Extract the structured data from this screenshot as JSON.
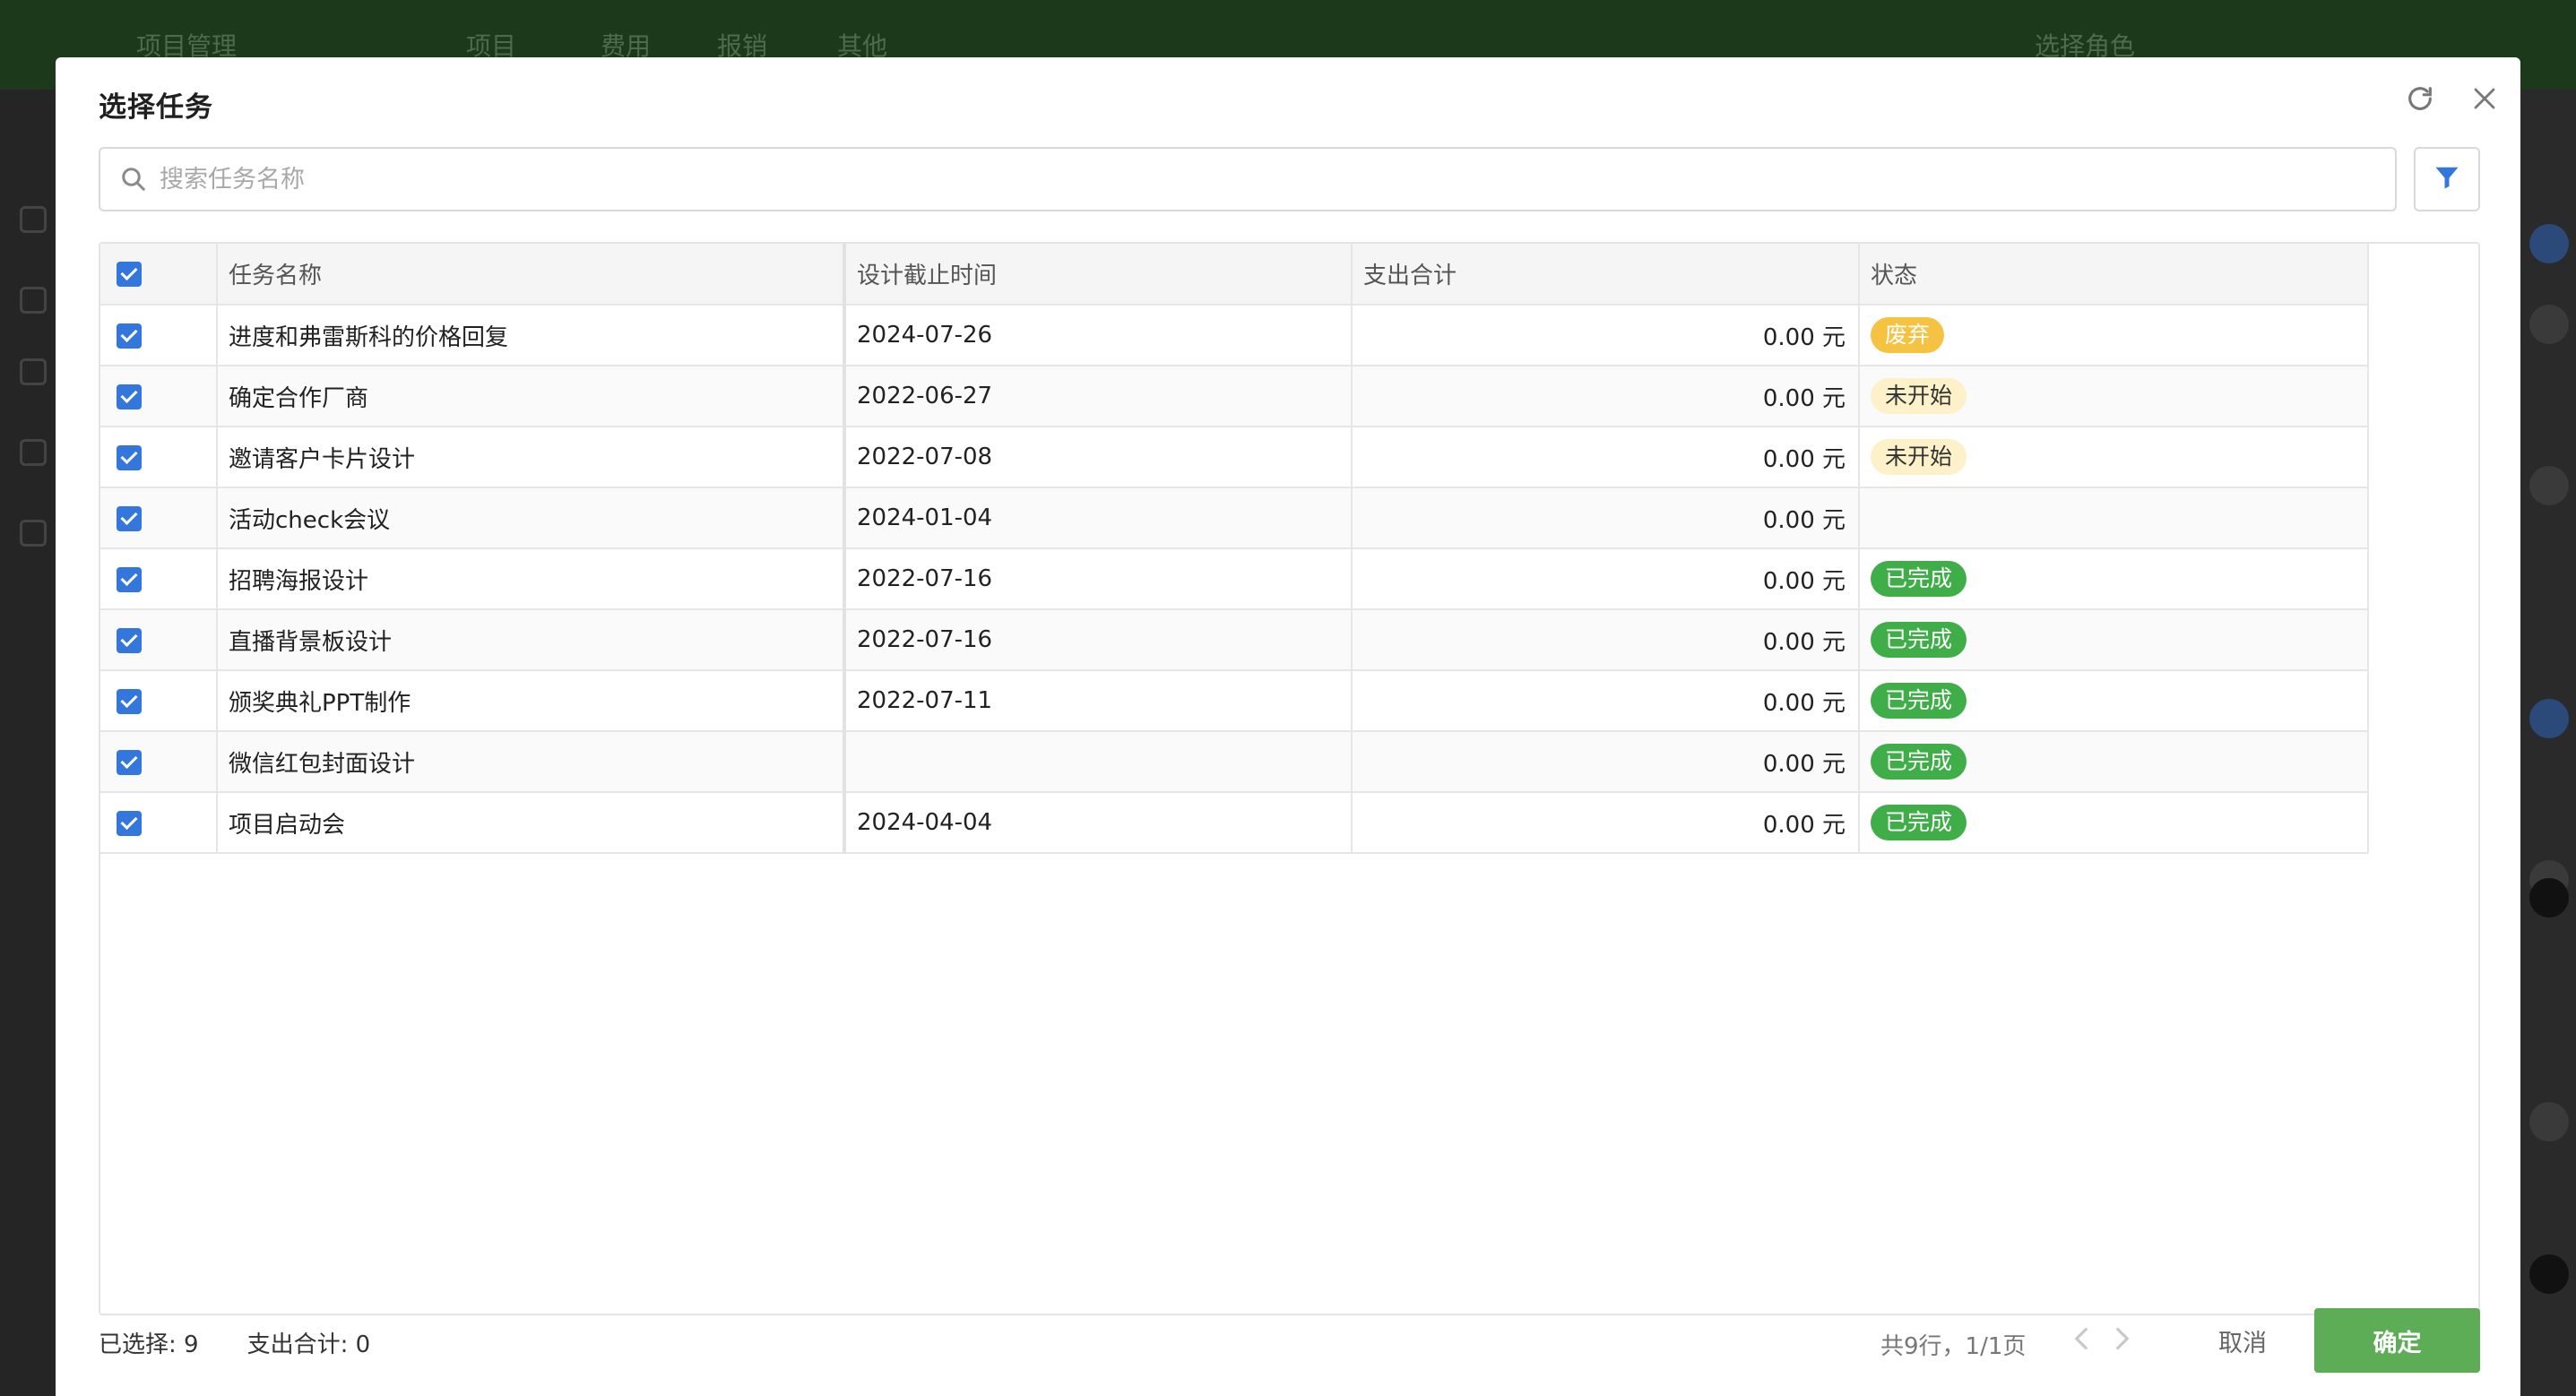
{
  "background": {
    "nav": [
      "项目管理",
      "项目",
      "费用",
      "报销",
      "其他"
    ],
    "role_select": "选择角色"
  },
  "dialog": {
    "title": "选择任务",
    "search_placeholder": "搜索任务名称",
    "columns": [
      "任务名称",
      "设计截止时间",
      "支出合计",
      "状态"
    ],
    "rows": [
      {
        "name": "进度和弗雷斯科的价格回复",
        "deadline": "2024-07-26",
        "expense": "0.00 元",
        "status": "废弃",
        "status_type": "abandon"
      },
      {
        "name": "确定合作厂商",
        "deadline": "2022-06-27",
        "expense": "0.00 元",
        "status": "未开始",
        "status_type": "notstart"
      },
      {
        "name": "邀请客户卡片设计",
        "deadline": "2022-07-08",
        "expense": "0.00 元",
        "status": "未开始",
        "status_type": "notstart"
      },
      {
        "name": "活动check会议",
        "deadline": "2024-01-04",
        "expense": "0.00 元",
        "status": "",
        "status_type": "none"
      },
      {
        "name": "招聘海报设计",
        "deadline": "2022-07-16",
        "expense": "0.00 元",
        "status": "已完成",
        "status_type": "done"
      },
      {
        "name": "直播背景板设计",
        "deadline": "2022-07-16",
        "expense": "0.00 元",
        "status": "已完成",
        "status_type": "done"
      },
      {
        "name": "颁奖典礼PPT制作",
        "deadline": "2022-07-11",
        "expense": "0.00 元",
        "status": "已完成",
        "status_type": "done"
      },
      {
        "name": "微信红包封面设计",
        "deadline": "",
        "expense": "0.00 元",
        "status": "已完成",
        "status_type": "done"
      },
      {
        "name": "项目启动会",
        "deadline": "2024-04-04",
        "expense": "0.00 元",
        "status": "已完成",
        "status_type": "done"
      }
    ],
    "footer": {
      "selected": "已选择: 9",
      "expense_total": "支出合计: 0",
      "pager_info": "共9行，1/1页",
      "cancel": "取消",
      "confirm": "确定"
    }
  },
  "colors": {
    "accent_blue": "#3377dd",
    "confirm_green": "#5cad55",
    "tag_done": "#3fae49",
    "tag_abandon": "#f5c242",
    "tag_notstart": "#fcf1c8"
  },
  "icons": [
    "refresh-icon",
    "close-icon",
    "search-icon",
    "filter-icon",
    "chevron-left-icon",
    "chevron-right-icon"
  ]
}
